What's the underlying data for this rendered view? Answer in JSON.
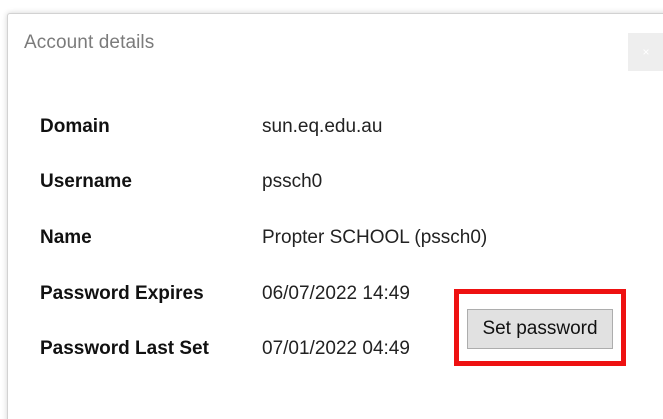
{
  "dialog": {
    "title": "Account details",
    "close_icon": "close-icon",
    "close_glyph": "×"
  },
  "fields": {
    "domain": {
      "label": "Domain",
      "value": "sun.eq.edu.au"
    },
    "username": {
      "label": "Username",
      "value": "pssch0"
    },
    "name": {
      "label": "Name",
      "value": "Propter SCHOOL (pssch0)"
    },
    "password_expires": {
      "label": "Password Expires",
      "value": "06/07/2022 14:49"
    },
    "password_last_set": {
      "label": "Password Last Set",
      "value": "07/01/2022 04:49"
    }
  },
  "actions": {
    "set_password_label": "Set password"
  },
  "colors": {
    "highlight": "#ee1111",
    "button_bg": "#e1e1e1",
    "title_text": "#7b7b7b"
  }
}
